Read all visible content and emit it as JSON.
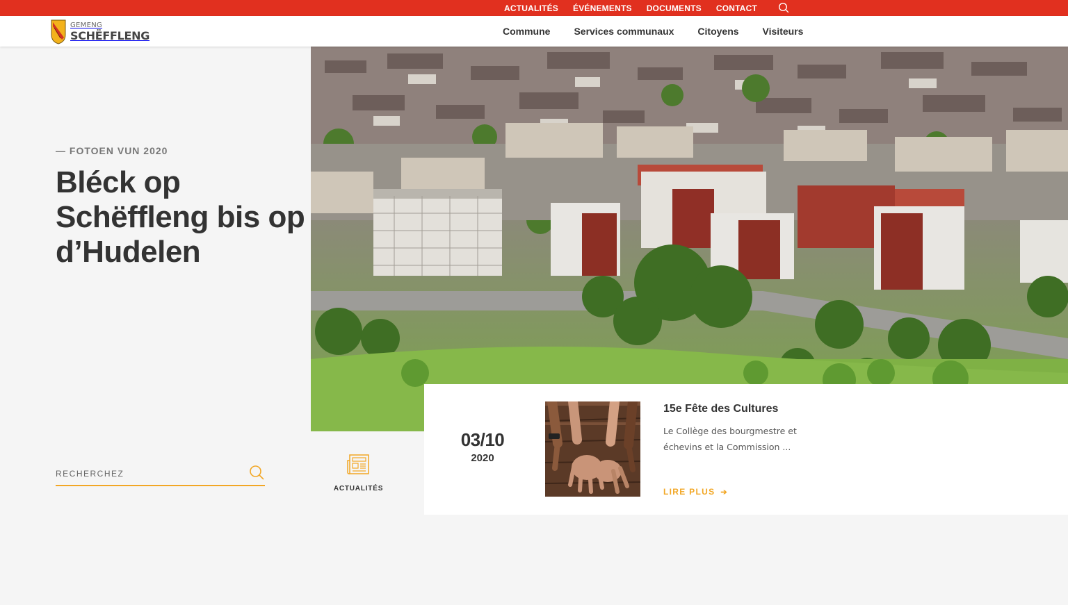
{
  "topbar": {
    "links": [
      "ACTUALITÉS",
      "ÉVÉNEMENTS",
      "DOCUMENTS",
      "CONTACT"
    ]
  },
  "header": {
    "logo_small": "GEMENG",
    "logo_big": "SCHËFFLENG",
    "nav": [
      "Commune",
      "Services communaux",
      "Citoyens",
      "Visiteurs"
    ]
  },
  "hero": {
    "eyebrow": "— FOTOEN VUN 2020",
    "title": "Bléck op Schëffleng bis op d’Hudelen"
  },
  "search": {
    "placeholder": "RECHERCHEZ"
  },
  "news_tab": {
    "label": "ACTUALITÉS"
  },
  "news": {
    "day": "03/10",
    "year": "2020",
    "title": "15e Fête des Cultures",
    "excerpt": "Le Collège des bourgmestre et échevins et la Commission ...",
    "more": "LIRE PLUS"
  },
  "colors": {
    "topbar": "#e1301f",
    "accent": "#f2a725",
    "background": "#f5f5f5"
  },
  "icons": {
    "topbar_search": "search-icon",
    "search": "search-icon",
    "news_tab": "newspaper-icon",
    "more": "arrow-right-icon",
    "logo": "coat-of-arms-icon"
  }
}
